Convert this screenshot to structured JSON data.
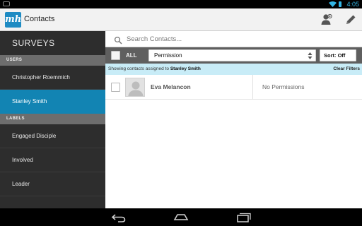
{
  "status_bar": {
    "time": "4:05"
  },
  "action_bar": {
    "logo_text": "mh",
    "title": "Contacts",
    "icons": [
      "add-person-icon",
      "edit-pencil-icon"
    ]
  },
  "sidebar": {
    "title": "SURVEYS",
    "users_header": "USERS",
    "users": [
      {
        "label": "Christopher Roemmich",
        "active": false
      },
      {
        "label": "Stanley Smith",
        "active": true
      }
    ],
    "labels_header": "LABELS",
    "labels": [
      {
        "label": "Engaged Disciple"
      },
      {
        "label": "Involved"
      },
      {
        "label": "Leader"
      }
    ]
  },
  "search": {
    "placeholder": "Search Contacts..."
  },
  "filter_bar": {
    "all_label": "ALL",
    "select_value": "Permission",
    "sort_label": "Sort: Off"
  },
  "info_bar": {
    "prefix": "Showing contacts assigned to",
    "user": "Stanley Smith",
    "clear_label": "Clear Filters"
  },
  "contacts": [
    {
      "name": "Eva Melancon",
      "permission": "No Permissions"
    }
  ],
  "colors": {
    "accent": "#1284b3",
    "sidebar_bg": "#2d2d2d",
    "info_bg": "#c8ecf7",
    "status_icons": "#33b5e5"
  }
}
